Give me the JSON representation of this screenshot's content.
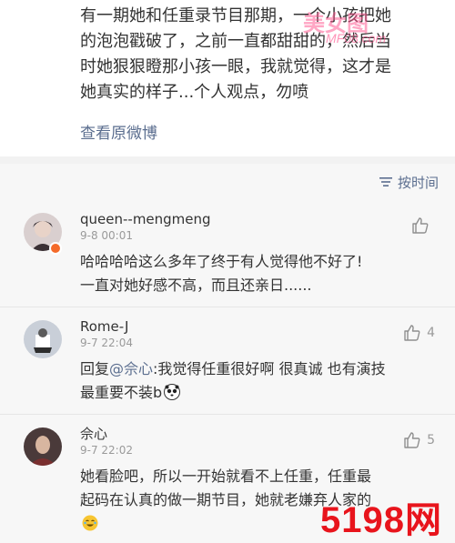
{
  "post": {
    "lines": [
      "有一期她和任重录节目那期，一个小孩把她",
      "的泡泡戳破了，之前一直都甜甜的，然后当",
      "时她狠狠瞪那小孩一眼，我就觉得，这才是",
      "她真实的样子...个人观点，勿喷"
    ],
    "view_original": "查看原微博"
  },
  "watermark_top": {
    "title": "美女图",
    "domain": "MF08.com"
  },
  "sort": {
    "label": "按时间"
  },
  "comments": [
    {
      "username": "queen--mengmeng",
      "time": "9-8 00:01",
      "lines": [
        "哈哈哈哈这么多年了终于有人觉得他不好了!",
        "一直对她好感不高，而且还亲日......"
      ],
      "likes": ""
    },
    {
      "username": "Rome-J",
      "time": "9-7 22:04",
      "reply_prefix": "回复",
      "mention": "@佘心",
      "reply_line1": ":我觉得任重很好啊 很真诚 也有演技",
      "reply_line2": "最重要不装b",
      "likes": "4"
    },
    {
      "username": "佘心",
      "time": "9-7 22:02",
      "lines": [
        "她看脸吧，所以一开始就看不上任重，任重最",
        "起码在认真的做一期节目，她就老嫌弃人家的"
      ],
      "likes": "5"
    }
  ],
  "watermark_bottom": {
    "text": "5198网"
  }
}
